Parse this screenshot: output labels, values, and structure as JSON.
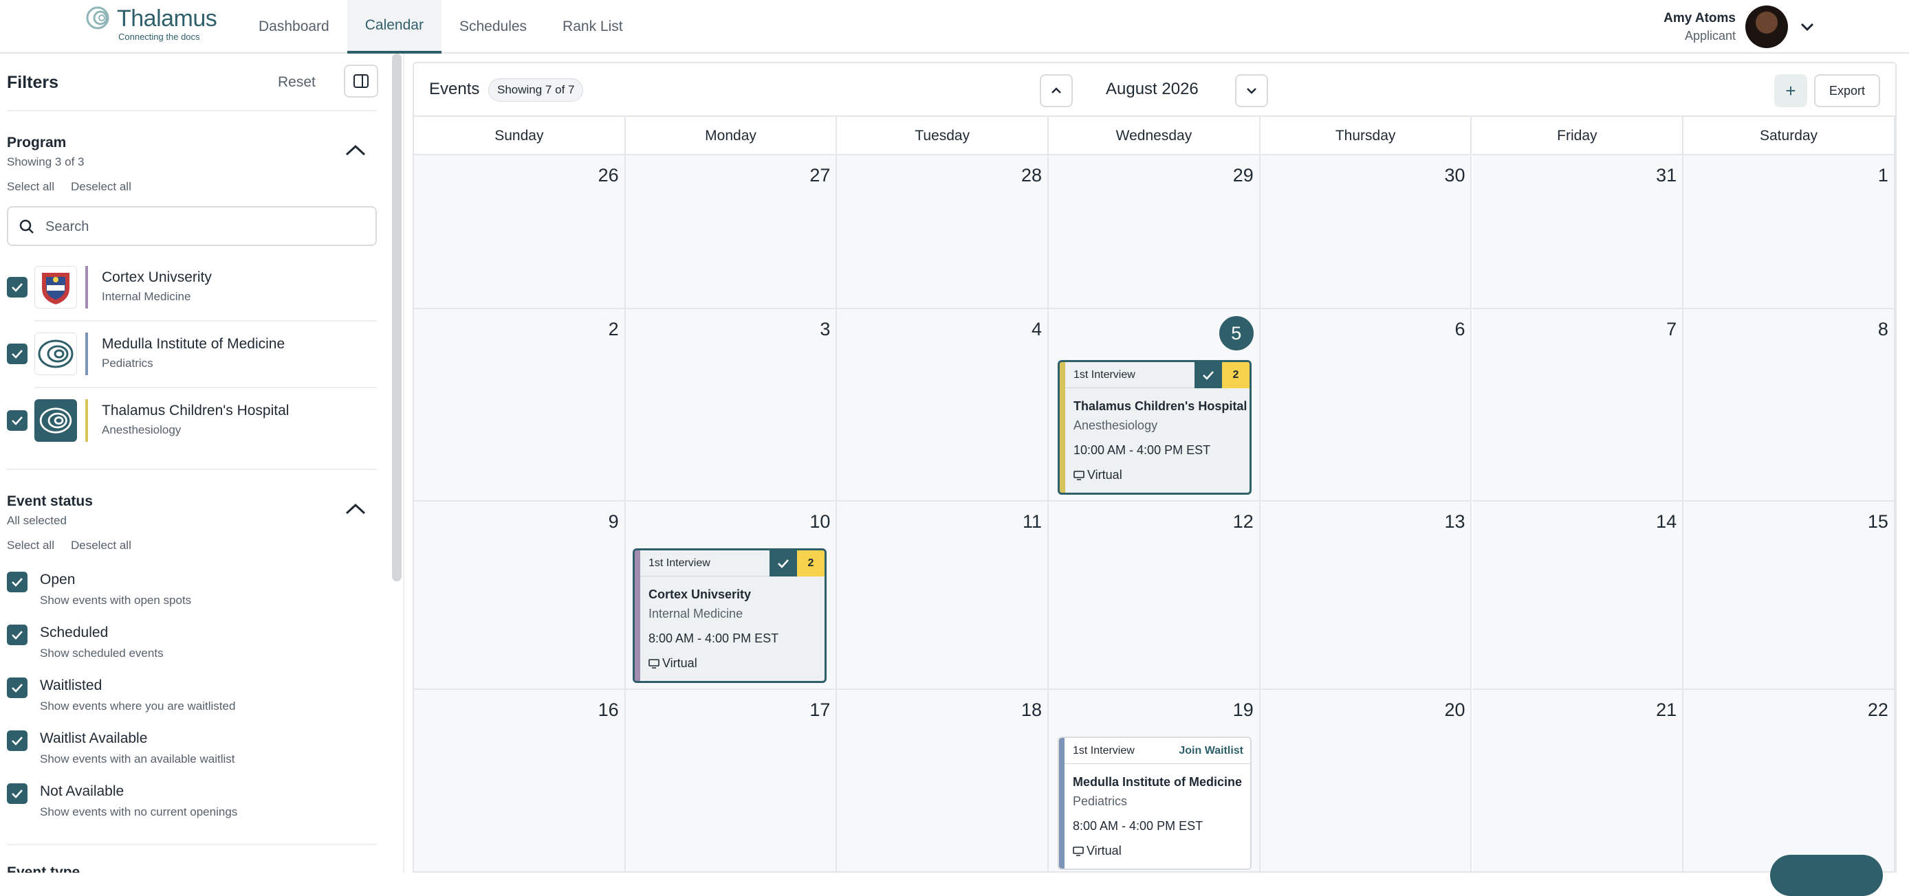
{
  "app": {
    "logo_name": "Thalamus",
    "logo_tagline": "Connecting the docs",
    "nav": [
      {
        "label": "Dashboard"
      },
      {
        "label": "Calendar"
      },
      {
        "label": "Schedules"
      },
      {
        "label": "Rank List"
      }
    ],
    "active_nav": "Calendar",
    "user": {
      "name": "Amy Atoms",
      "role": "Applicant"
    }
  },
  "filters": {
    "title": "Filters",
    "reset_label": "Reset",
    "program": {
      "title": "Program",
      "subtitle": "Showing 3 of 3",
      "select_all": "Select all",
      "deselect_all": "Deselect all",
      "search_placeholder": "Search",
      "items": [
        {
          "name": "Cortex Univserity",
          "specialty": "Internal Medicine",
          "checked": true,
          "color": "#a48bb0"
        },
        {
          "name": "Medulla Institute of Medicine",
          "specialty": "Pediatrics",
          "checked": true,
          "color": "#7d93b8"
        },
        {
          "name": "Thalamus Children's Hospital",
          "specialty": "Anesthesiology",
          "checked": true,
          "color": "#d8c25a"
        }
      ]
    },
    "event_status": {
      "title": "Event status",
      "subtitle": "All selected",
      "select_all": "Select all",
      "deselect_all": "Deselect all",
      "items": [
        {
          "label": "Open",
          "desc": "Show events with open spots",
          "checked": true
        },
        {
          "label": "Scheduled",
          "desc": "Show scheduled events",
          "checked": true
        },
        {
          "label": "Waitlisted",
          "desc": "Show events where you are waitlisted",
          "checked": true
        },
        {
          "label": "Waitlist Available",
          "desc": "Show events with an available waitlist",
          "checked": true
        },
        {
          "label": "Not Available",
          "desc": "Show events with no current openings",
          "checked": true
        }
      ]
    },
    "next_section": "Event type"
  },
  "calendar": {
    "events_label": "Events",
    "showing": "Showing 7 of 7",
    "month": "August 2026",
    "export_label": "Export",
    "add_label": "+",
    "weekdays": [
      "Sunday",
      "Monday",
      "Tuesday",
      "Wednesday",
      "Thursday",
      "Friday",
      "Saturday"
    ],
    "weeks": [
      [
        "26",
        "27",
        "28",
        "29",
        "30",
        "31",
        "1"
      ],
      [
        "2",
        "3",
        "4",
        "5",
        "6",
        "7",
        "8"
      ],
      [
        "9",
        "10",
        "11",
        "12",
        "13",
        "14",
        "15"
      ],
      [
        "16",
        "17",
        "18",
        "19",
        "20",
        "21",
        "22"
      ]
    ],
    "today": "5",
    "events": [
      {
        "type": "1st Interview",
        "org": "Thalamus Children's Hospital",
        "specialty": "Anesthesiology",
        "time": "10:00 AM - 4:00 PM EST",
        "location": "Virtual",
        "badge": "2",
        "scheduled": true,
        "color": "#d8c25a"
      },
      {
        "type": "1st Interview",
        "org": "Cortex Univserity",
        "specialty": "Internal Medicine",
        "time": "8:00 AM - 4:00 PM EST",
        "location": "Virtual",
        "badge": "2",
        "scheduled": true,
        "color": "#a48bb0"
      },
      {
        "type": "1st Interview",
        "org": "Medulla Institute of Medicine",
        "specialty": "Pediatrics",
        "time": "8:00 AM - 4:00 PM EST",
        "location": "Virtual",
        "action": "Join Waitlist",
        "color": "#7d93b8"
      }
    ]
  }
}
